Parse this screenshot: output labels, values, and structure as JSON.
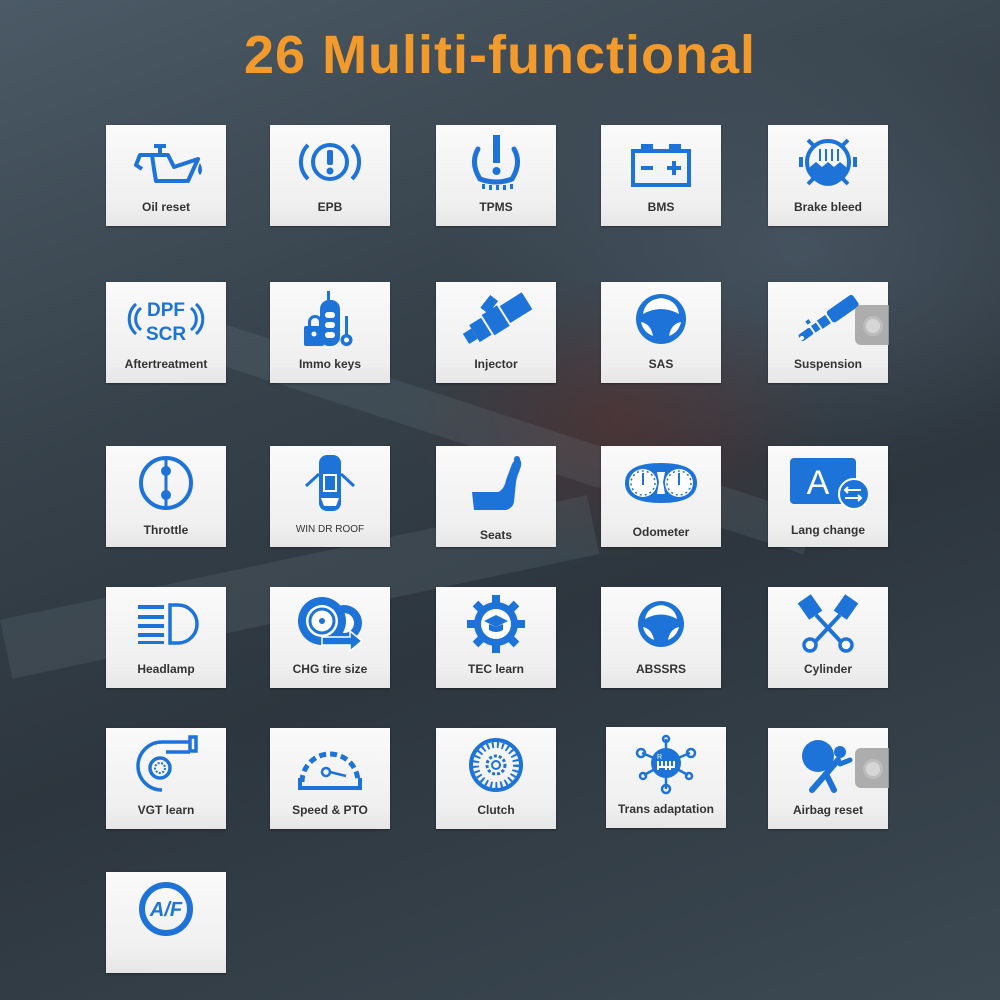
{
  "header": {
    "title": "26 Muliti-functional"
  },
  "accent_color": "#1e73d8",
  "title_color": "#f39a2c",
  "functions": [
    {
      "label": "Oil reset",
      "icon": "oil-can-icon"
    },
    {
      "label": "EPB",
      "icon": "parking-brake-warning-icon"
    },
    {
      "label": "TPMS",
      "icon": "tire-pressure-icon"
    },
    {
      "label": "BMS",
      "icon": "battery-icon"
    },
    {
      "label": "Brake bleed",
      "icon": "brake-fluid-icon"
    },
    {
      "label": "Aftertreatment",
      "icon": "dpf-scr-icon",
      "icon_text_top": "DPF",
      "icon_text_bottom": "SCR"
    },
    {
      "label": "Immo keys",
      "icon": "immobilizer-key-icon"
    },
    {
      "label": "Injector",
      "icon": "injector-icon"
    },
    {
      "label": "SAS",
      "icon": "steering-wheel-icon"
    },
    {
      "label": "Suspension",
      "icon": "suspension-icon"
    },
    {
      "label": "Throttle",
      "icon": "throttle-icon"
    },
    {
      "label": "WIN DR ROOF",
      "icon": "car-doors-icon"
    },
    {
      "label": "Seats",
      "icon": "seat-icon"
    },
    {
      "label": "Odometer",
      "icon": "odometer-icon"
    },
    {
      "label": "Lang change",
      "icon": "language-change-icon",
      "icon_text": "A"
    },
    {
      "label": "Headlamp",
      "icon": "headlamp-icon"
    },
    {
      "label": "CHG tire size",
      "icon": "tire-size-icon"
    },
    {
      "label": "TEC learn",
      "icon": "gear-graduation-icon"
    },
    {
      "label": "ABSSRS",
      "icon": "steering-wheel-icon"
    },
    {
      "label": "Cylinder",
      "icon": "pistons-icon"
    },
    {
      "label": "VGT learn",
      "icon": "turbo-icon"
    },
    {
      "label": "Speed & PTO",
      "icon": "speedometer-icon"
    },
    {
      "label": "Clutch",
      "icon": "clutch-icon"
    },
    {
      "label": "Trans adaptation",
      "icon": "gear-shift-icon",
      "icon_text": "R"
    },
    {
      "label": "Airbag reset",
      "icon": "airbag-icon"
    },
    {
      "label": "",
      "icon": "af-icon",
      "icon_text": "A/F"
    }
  ]
}
